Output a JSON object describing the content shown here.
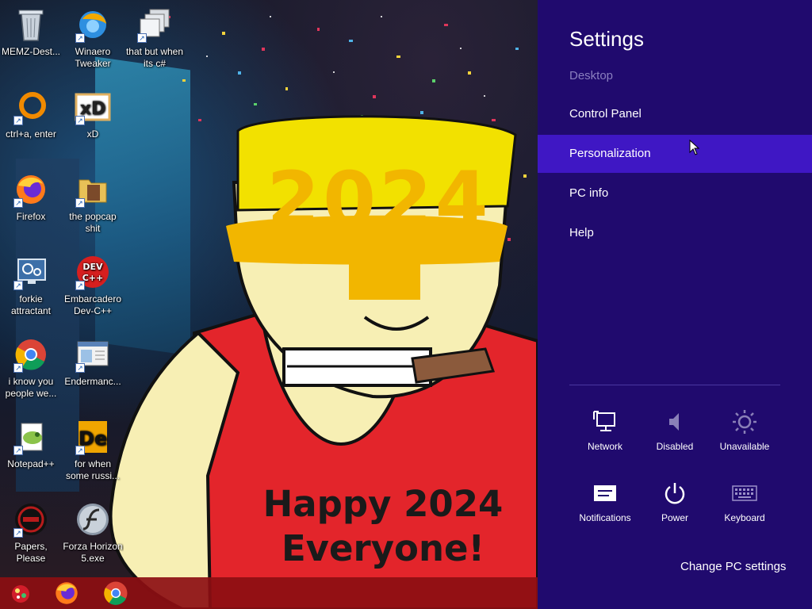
{
  "desktop": {
    "wallpaper": {
      "year_text": "2024",
      "greeting_line1": "Happy 2024",
      "greeting_line2": "Everyone!"
    },
    "icons": [
      {
        "label": "MEMZ-Dest...",
        "icon": "recycle-bin-icon"
      },
      {
        "label": "Winaero Tweaker",
        "icon": "winaero-tweaker-icon"
      },
      {
        "label": "that but when its c#",
        "icon": "stacked-windows-icon"
      },
      {
        "label": "ctrl+a, enter",
        "icon": "orange-ring-icon"
      },
      {
        "label": "xD",
        "icon": "xd-icon"
      },
      {
        "label": "Firefox",
        "icon": "firefox-icon"
      },
      {
        "label": "the popcap shit",
        "icon": "folder-icon"
      },
      {
        "label": "forkie attractant",
        "icon": "settings-monitor-icon"
      },
      {
        "label": "Embarcadero Dev-C++",
        "icon": "dev-cpp-icon"
      },
      {
        "label": "i know you people we...",
        "icon": "chrome-icon"
      },
      {
        "label": "Endermanc...",
        "icon": "app-window-icon"
      },
      {
        "label": "Notepad++",
        "icon": "notepad-plus-plus-icon"
      },
      {
        "label": "for when some russi...",
        "icon": "de-icon"
      },
      {
        "label": "Papers, Please",
        "icon": "papers-please-icon"
      },
      {
        "label": "Forza Horizon 5.exe",
        "icon": "flash-icon"
      }
    ],
    "taskbar": [
      {
        "name": "start-button",
        "icon": "start-ornament-icon"
      },
      {
        "name": "taskbar-firefox",
        "icon": "firefox-icon"
      },
      {
        "name": "taskbar-chrome",
        "icon": "chrome-icon"
      }
    ]
  },
  "settings": {
    "title": "Settings",
    "subtitle": "Desktop",
    "items": [
      {
        "label": "Control Panel"
      },
      {
        "label": "Personalization",
        "selected": true
      },
      {
        "label": "PC info"
      },
      {
        "label": "Help"
      }
    ],
    "tiles": [
      {
        "label": "Network",
        "icon": "network-icon"
      },
      {
        "label": "Disabled",
        "icon": "speaker-icon"
      },
      {
        "label": "Unavailable",
        "icon": "brightness-icon"
      },
      {
        "label": "Notifications",
        "icon": "notifications-icon"
      },
      {
        "label": "Power",
        "icon": "power-icon"
      },
      {
        "label": "Keyboard",
        "icon": "keyboard-icon"
      }
    ],
    "change_pc_settings": "Change PC settings"
  },
  "colors": {
    "charm_bg": "#200a6e",
    "charm_selected": "#3f17c4",
    "taskbar_bg": "#8c0e12",
    "art_yellow": "#f2b600",
    "art_shirt_red": "#e3252b",
    "art_skin": "#f7efb4"
  }
}
